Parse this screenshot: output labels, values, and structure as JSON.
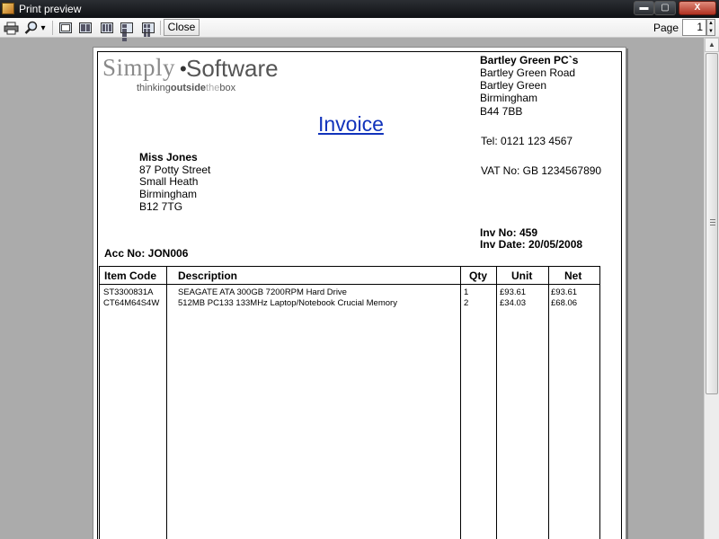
{
  "window": {
    "title": "Print preview",
    "min_symbol": "▬",
    "max_symbol": "▢",
    "close_symbol": "X"
  },
  "toolbar": {
    "close_label": "Close",
    "page_label": "Page",
    "page_value": "1",
    "zoom_dropdown_symbol": "▾"
  },
  "invoice": {
    "logo": {
      "word1": "Simply",
      "dot": "•",
      "word2": "Software",
      "tagline": [
        "thinking",
        "outside",
        "the",
        "box"
      ]
    },
    "title": "Invoice",
    "company": {
      "name": "Bartley Green PC`s",
      "address": [
        "Bartley Green Road",
        "Bartley Green",
        "Birmingham",
        "B44 7BB"
      ],
      "tel": "Tel:  0121 123 4567",
      "vat": "VAT No: GB 1234567890"
    },
    "customer": {
      "name": "Miss Jones",
      "address": [
        "87 Potty Street",
        "Small Heath",
        "Birmingham",
        "B12 7TG"
      ]
    },
    "inv_no": "Inv No: 459",
    "inv_date": "Inv Date: 20/05/2008",
    "acc_no": "Acc No: JON006",
    "columns": [
      "Item Code",
      "Description",
      "Qty",
      "Unit",
      "Net"
    ],
    "items": [
      {
        "code": "ST3300831A",
        "description": "SEAGATE ATA 300GB 7200RPM Hard Drive",
        "qty": "1",
        "unit": "£93.61",
        "net": "£93.61"
      },
      {
        "code": "CT64M64S4W",
        "description": "512MB PC133 133MHz Laptop/Notebook Crucial Memory",
        "qty": "2",
        "unit": "£34.03",
        "net": "£68.06"
      }
    ]
  },
  "icons": [
    "printer-icon",
    "magnifier-icon",
    "one-page-icon",
    "two-pages-icon",
    "three-pages-icon",
    "four-pages-icon",
    "six-pages-icon"
  ]
}
